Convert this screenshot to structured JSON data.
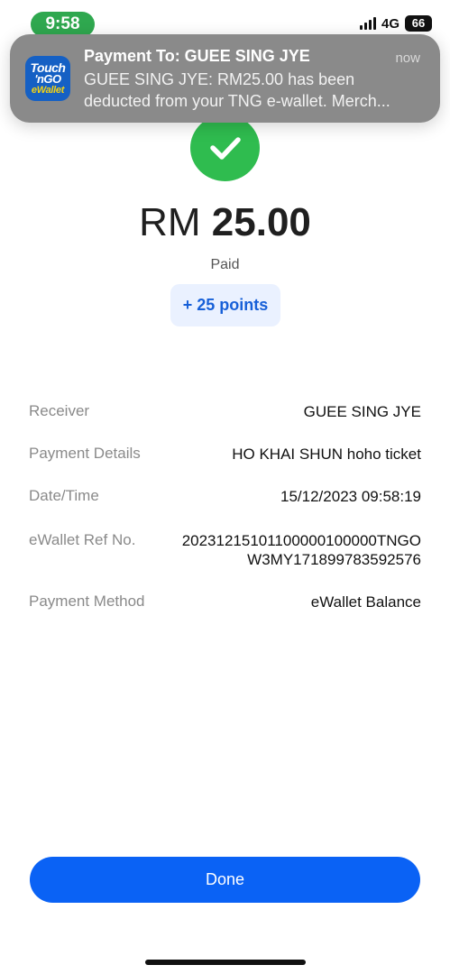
{
  "status_bar": {
    "time": "9:58",
    "network": "4G",
    "battery": "66"
  },
  "notification": {
    "app_icon": {
      "name": "touch-n-go-ewallet-icon",
      "logo_line1": "Touch",
      "logo_line2": "'nGO",
      "logo_line3": "eWallet"
    },
    "title": "Payment To: GUEE SING JYE",
    "time": "now",
    "body": "GUEE SING JYE: RM25.00 has been deducted from your TNG e-wallet. Merch..."
  },
  "receipt": {
    "currency": "RM",
    "amount": "25.00",
    "status": "Paid",
    "points": "+ 25 points"
  },
  "details": [
    {
      "label": "Receiver",
      "value_lines": [
        "GUEE SING JYE"
      ]
    },
    {
      "label": "Payment Details",
      "value_lines": [
        "HO KHAI SHUN hoho ticket"
      ]
    },
    {
      "label": "Date/Time",
      "value_lines": [
        "15/12/2023 09:58:19"
      ]
    },
    {
      "label": "eWallet Ref No.",
      "value_lines": [
        "20231215101100000100000TNGO",
        "W3MY171899783592576"
      ]
    },
    {
      "label": "Payment Method",
      "value_lines": [
        "eWallet Balance"
      ]
    }
  ],
  "actions": {
    "done_label": "Done"
  },
  "colors": {
    "primary": "#0a62f5",
    "success": "#2fbc4f",
    "time_pill": "#2fa84f",
    "points_bg": "#eaf1ff",
    "points_text": "#1760d8"
  }
}
